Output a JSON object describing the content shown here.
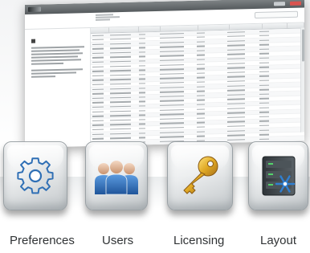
{
  "tiles": [
    {
      "id": "preferences",
      "label": "Preferences",
      "icon": "gear-icon"
    },
    {
      "id": "users",
      "label": "Users",
      "icon": "users-group-icon"
    },
    {
      "id": "licensing",
      "label": "Licensing",
      "icon": "key-icon"
    },
    {
      "id": "layout",
      "label": "Layout",
      "icon": "server-snowflake-icon"
    }
  ],
  "colors": {
    "gear_blue": "#2f6fb5",
    "users_blue": "#2a6cb6",
    "key_gold": "#e0a924",
    "server_dark": "#3b4247",
    "snowflake_blue": "#2f7fd1",
    "label_text": "#303335"
  }
}
